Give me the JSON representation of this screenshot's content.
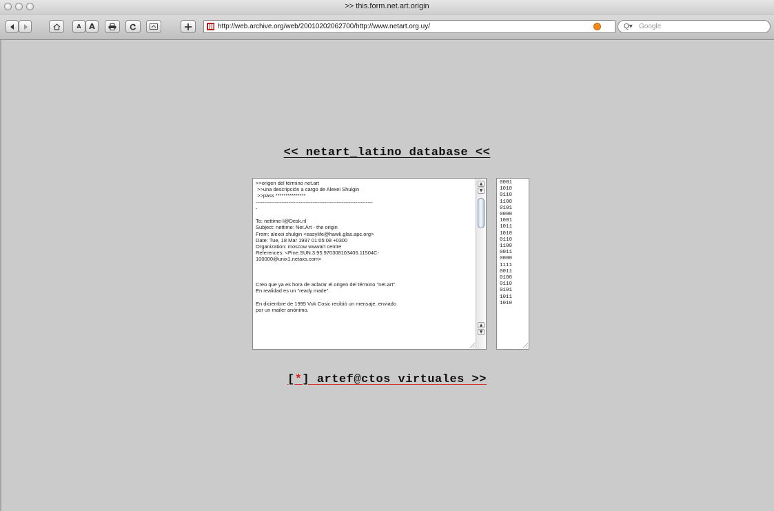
{
  "window": {
    "title": ">> this.form.net.art.origin"
  },
  "toolbar": {
    "text_smaller_label": "A",
    "text_bigger_label": "A",
    "url": "http://web.archive.org/web/20010202062700/http://www.netart.org.uy/",
    "search_placeholder": "Google",
    "search_prefix": "Q▾"
  },
  "page": {
    "heading": "<< netart_latino database <<",
    "textarea_lines": [
      ">>origen del término net.art",
      " >>una descripción a cargo de Alexei Shulgin",
      " >>pass ***************",
      "--------------------------------------------------------------------",
      "-",
      "",
      "To: nettime-l@Desk.nl",
      "Subject: nettime: Net.Art - the origin",
      "From: alexei shulgin <easylife@hawk.glas.apc.org>",
      "Date: Tue, 18 Mar 1997 01:05:08 +0300",
      "Organization: moscow wwwart centre",
      "References: <Pine.SUN.3.95.970308103406.11504C-",
      "100000@unix1.netaxs.com>",
      "",
      "",
      "",
      "Creo que ya es hora de aclarar el origen del término \"net.art\".",
      "En realidad es un \"ready made\".",
      "",
      "En diciembre de 1995 Vuk Cosic recibió un mensaje, enviado",
      "por un mailer anónimo."
    ],
    "binary_values": [
      "0001",
      "1010",
      "0110",
      "1100",
      "0101",
      "0000",
      "1001",
      "1011",
      "1010",
      "0110",
      "1100",
      "0011",
      "0000",
      "1111",
      "0011",
      "0100",
      "0110",
      "0101",
      "1011",
      "1010"
    ],
    "footer_link": {
      "open": "[",
      "star": "*",
      "close": "]",
      "text": " artef@ctos virtuales >>"
    }
  }
}
